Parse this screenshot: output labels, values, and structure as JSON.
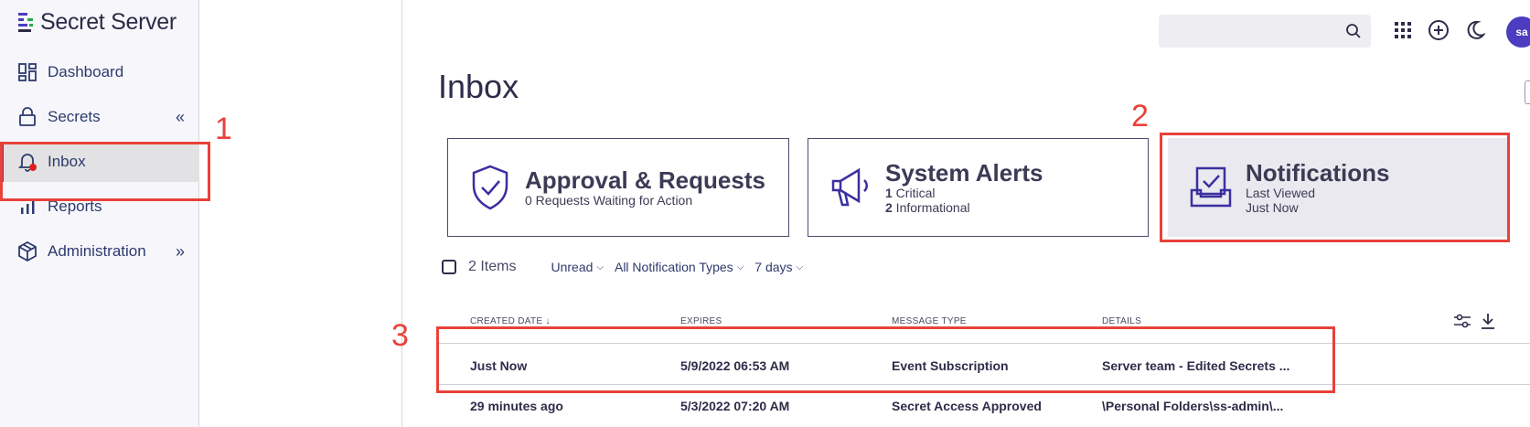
{
  "app": {
    "title": "Secret Server"
  },
  "sidebar": {
    "items": [
      {
        "label": "Dashboard",
        "icon": "dashboard-icon"
      },
      {
        "label": "Secrets",
        "icon": "lock-icon",
        "chevron": "«"
      },
      {
        "label": "Inbox",
        "icon": "bell-icon"
      },
      {
        "label": "Reports",
        "icon": "bar-chart-icon"
      },
      {
        "label": "Administration",
        "icon": "cube-icon",
        "chevron": "»"
      }
    ]
  },
  "topbar": {
    "search_placeholder": "",
    "avatar": "sa"
  },
  "page": {
    "title": "Inbox"
  },
  "cards": [
    {
      "title": "Approval & Requests",
      "line1": "0 Requests Waiting for Action"
    },
    {
      "title": "System Alerts",
      "line1_num": "1",
      "line1_text": " Critical",
      "line2_num": "2",
      "line2_text": " Informational"
    },
    {
      "title": "Notifications",
      "line1": "Last Viewed",
      "line2": "Just Now"
    }
  ],
  "filters": {
    "count": "2 Items",
    "unread": "Unread",
    "types": "All Notification Types",
    "period": "7 days"
  },
  "table": {
    "columns": [
      "CREATED DATE",
      "EXPIRES",
      "MESSAGE TYPE",
      "DETAILS"
    ],
    "rows": [
      {
        "created": "Just Now",
        "expires": "5/9/2022 06:53 AM",
        "type": "Event Subscription",
        "details": "Server team - Edited Secrets ..."
      },
      {
        "created": "29 minutes ago",
        "expires": "5/3/2022 07:20 AM",
        "type": "Secret Access Approved",
        "details": "\\Personal Folders\\ss-admin\\..."
      }
    ]
  },
  "callouts": [
    "1",
    "2",
    "3"
  ],
  "colors": {
    "accent": "#4b3cc0",
    "callout": "#e8423a",
    "notification_dot": "#e02020"
  }
}
